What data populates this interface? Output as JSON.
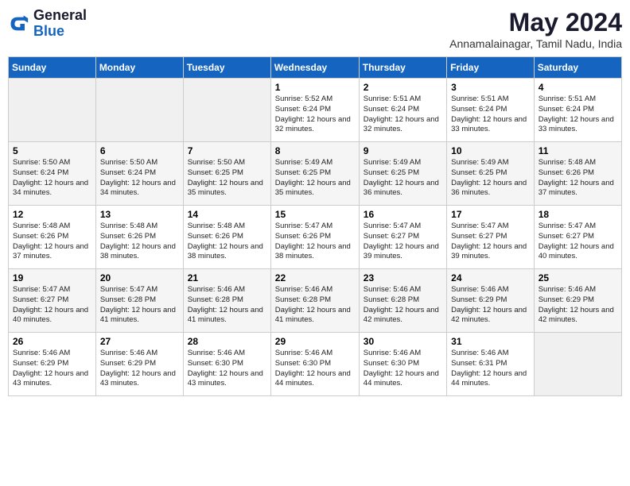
{
  "header": {
    "logo_general": "General",
    "logo_blue": "Blue",
    "month_year": "May 2024",
    "location": "Annamalainagar, Tamil Nadu, India"
  },
  "days_of_week": [
    "Sunday",
    "Monday",
    "Tuesday",
    "Wednesday",
    "Thursday",
    "Friday",
    "Saturday"
  ],
  "weeks": [
    [
      {
        "day": "",
        "info": ""
      },
      {
        "day": "",
        "info": ""
      },
      {
        "day": "",
        "info": ""
      },
      {
        "day": "1",
        "info": "Sunrise: 5:52 AM\nSunset: 6:24 PM\nDaylight: 12 hours and 32 minutes."
      },
      {
        "day": "2",
        "info": "Sunrise: 5:51 AM\nSunset: 6:24 PM\nDaylight: 12 hours and 32 minutes."
      },
      {
        "day": "3",
        "info": "Sunrise: 5:51 AM\nSunset: 6:24 PM\nDaylight: 12 hours and 33 minutes."
      },
      {
        "day": "4",
        "info": "Sunrise: 5:51 AM\nSunset: 6:24 PM\nDaylight: 12 hours and 33 minutes."
      }
    ],
    [
      {
        "day": "5",
        "info": "Sunrise: 5:50 AM\nSunset: 6:24 PM\nDaylight: 12 hours and 34 minutes."
      },
      {
        "day": "6",
        "info": "Sunrise: 5:50 AM\nSunset: 6:24 PM\nDaylight: 12 hours and 34 minutes."
      },
      {
        "day": "7",
        "info": "Sunrise: 5:50 AM\nSunset: 6:25 PM\nDaylight: 12 hours and 35 minutes."
      },
      {
        "day": "8",
        "info": "Sunrise: 5:49 AM\nSunset: 6:25 PM\nDaylight: 12 hours and 35 minutes."
      },
      {
        "day": "9",
        "info": "Sunrise: 5:49 AM\nSunset: 6:25 PM\nDaylight: 12 hours and 36 minutes."
      },
      {
        "day": "10",
        "info": "Sunrise: 5:49 AM\nSunset: 6:25 PM\nDaylight: 12 hours and 36 minutes."
      },
      {
        "day": "11",
        "info": "Sunrise: 5:48 AM\nSunset: 6:26 PM\nDaylight: 12 hours and 37 minutes."
      }
    ],
    [
      {
        "day": "12",
        "info": "Sunrise: 5:48 AM\nSunset: 6:26 PM\nDaylight: 12 hours and 37 minutes."
      },
      {
        "day": "13",
        "info": "Sunrise: 5:48 AM\nSunset: 6:26 PM\nDaylight: 12 hours and 38 minutes."
      },
      {
        "day": "14",
        "info": "Sunrise: 5:48 AM\nSunset: 6:26 PM\nDaylight: 12 hours and 38 minutes."
      },
      {
        "day": "15",
        "info": "Sunrise: 5:47 AM\nSunset: 6:26 PM\nDaylight: 12 hours and 38 minutes."
      },
      {
        "day": "16",
        "info": "Sunrise: 5:47 AM\nSunset: 6:27 PM\nDaylight: 12 hours and 39 minutes."
      },
      {
        "day": "17",
        "info": "Sunrise: 5:47 AM\nSunset: 6:27 PM\nDaylight: 12 hours and 39 minutes."
      },
      {
        "day": "18",
        "info": "Sunrise: 5:47 AM\nSunset: 6:27 PM\nDaylight: 12 hours and 40 minutes."
      }
    ],
    [
      {
        "day": "19",
        "info": "Sunrise: 5:47 AM\nSunset: 6:27 PM\nDaylight: 12 hours and 40 minutes."
      },
      {
        "day": "20",
        "info": "Sunrise: 5:47 AM\nSunset: 6:28 PM\nDaylight: 12 hours and 41 minutes."
      },
      {
        "day": "21",
        "info": "Sunrise: 5:46 AM\nSunset: 6:28 PM\nDaylight: 12 hours and 41 minutes."
      },
      {
        "day": "22",
        "info": "Sunrise: 5:46 AM\nSunset: 6:28 PM\nDaylight: 12 hours and 41 minutes."
      },
      {
        "day": "23",
        "info": "Sunrise: 5:46 AM\nSunset: 6:28 PM\nDaylight: 12 hours and 42 minutes."
      },
      {
        "day": "24",
        "info": "Sunrise: 5:46 AM\nSunset: 6:29 PM\nDaylight: 12 hours and 42 minutes."
      },
      {
        "day": "25",
        "info": "Sunrise: 5:46 AM\nSunset: 6:29 PM\nDaylight: 12 hours and 42 minutes."
      }
    ],
    [
      {
        "day": "26",
        "info": "Sunrise: 5:46 AM\nSunset: 6:29 PM\nDaylight: 12 hours and 43 minutes."
      },
      {
        "day": "27",
        "info": "Sunrise: 5:46 AM\nSunset: 6:29 PM\nDaylight: 12 hours and 43 minutes."
      },
      {
        "day": "28",
        "info": "Sunrise: 5:46 AM\nSunset: 6:30 PM\nDaylight: 12 hours and 43 minutes."
      },
      {
        "day": "29",
        "info": "Sunrise: 5:46 AM\nSunset: 6:30 PM\nDaylight: 12 hours and 44 minutes."
      },
      {
        "day": "30",
        "info": "Sunrise: 5:46 AM\nSunset: 6:30 PM\nDaylight: 12 hours and 44 minutes."
      },
      {
        "day": "31",
        "info": "Sunrise: 5:46 AM\nSunset: 6:31 PM\nDaylight: 12 hours and 44 minutes."
      },
      {
        "day": "",
        "info": ""
      }
    ]
  ]
}
